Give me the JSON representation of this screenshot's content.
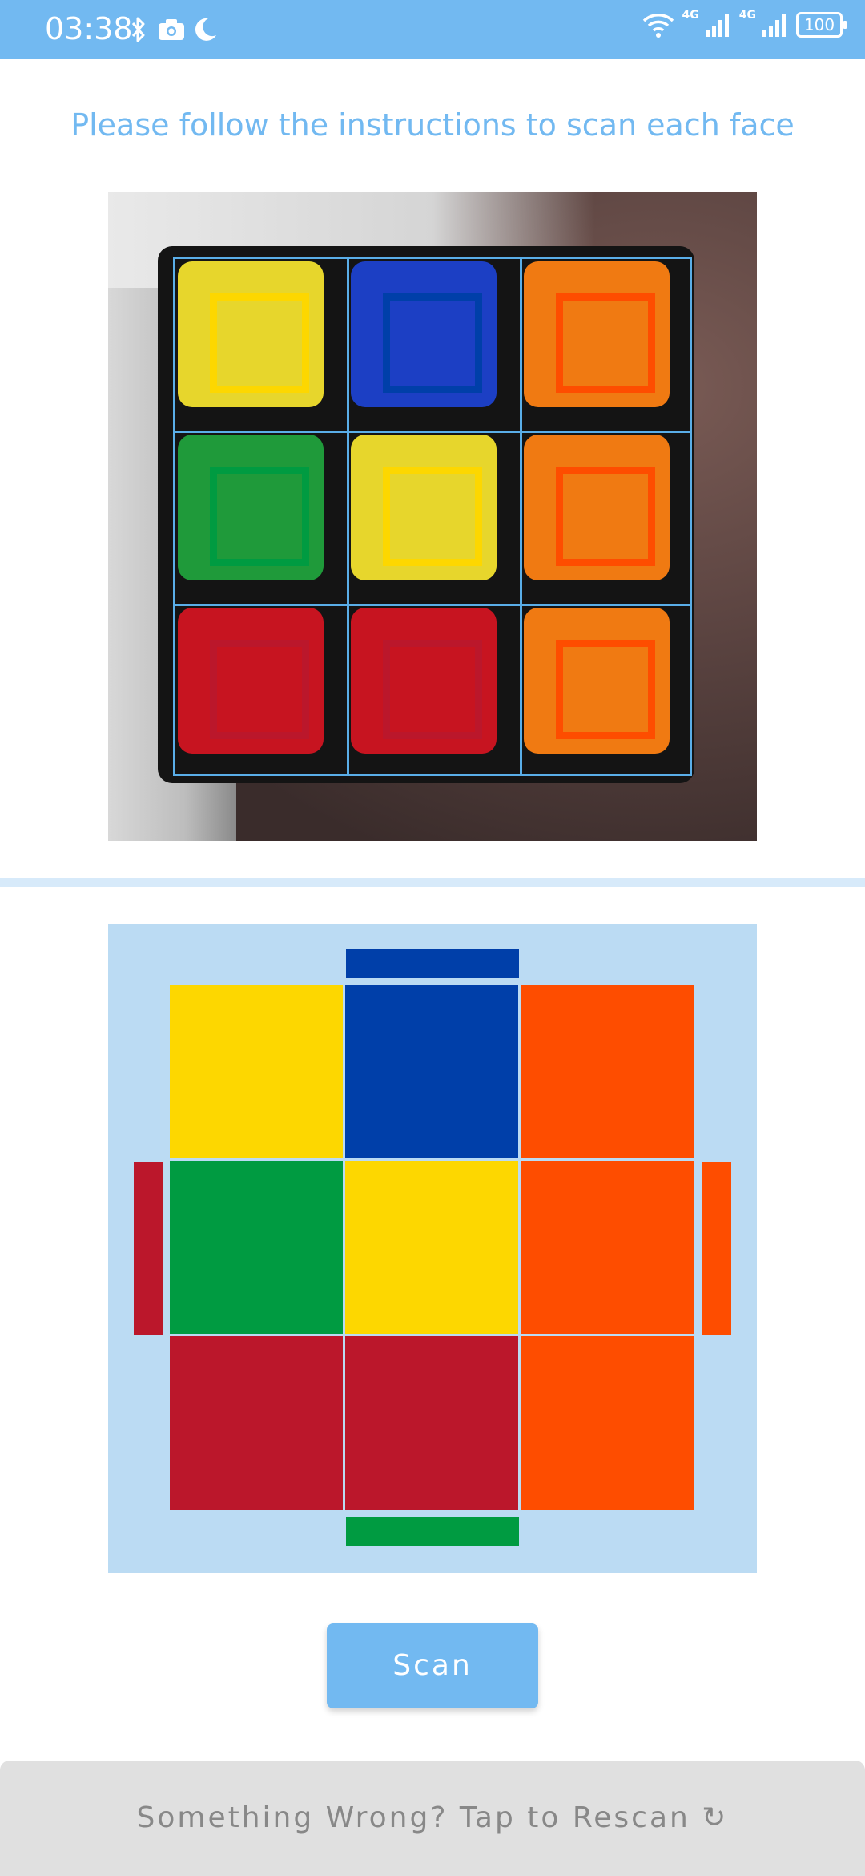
{
  "status_bar": {
    "time": "03:38",
    "net_label_1": "4G",
    "net_label_2": "4G",
    "battery": "100"
  },
  "instruction": "Please follow the instructions to scan each face",
  "camera_preview": {
    "stickers": [
      "yellow",
      "blue",
      "orange",
      "green",
      "yellow",
      "orange",
      "red",
      "red",
      "orange"
    ]
  },
  "cube_net": {
    "face": [
      "yellow",
      "blue",
      "orange",
      "green",
      "yellow",
      "orange",
      "red",
      "red",
      "orange"
    ],
    "top_edge": "blue",
    "bottom_edge": "green",
    "left_edge": "red",
    "right_edge": "orange"
  },
  "colors": {
    "accent": "#72b9f1",
    "yellow": "#fdd700",
    "blue": "#003fa9",
    "orange": "#fe4d00",
    "green": "#009b41",
    "red": "#bb172b"
  },
  "buttons": {
    "scan": "Scan",
    "rescan": "Something Wrong? Tap to Rescan ↻"
  }
}
